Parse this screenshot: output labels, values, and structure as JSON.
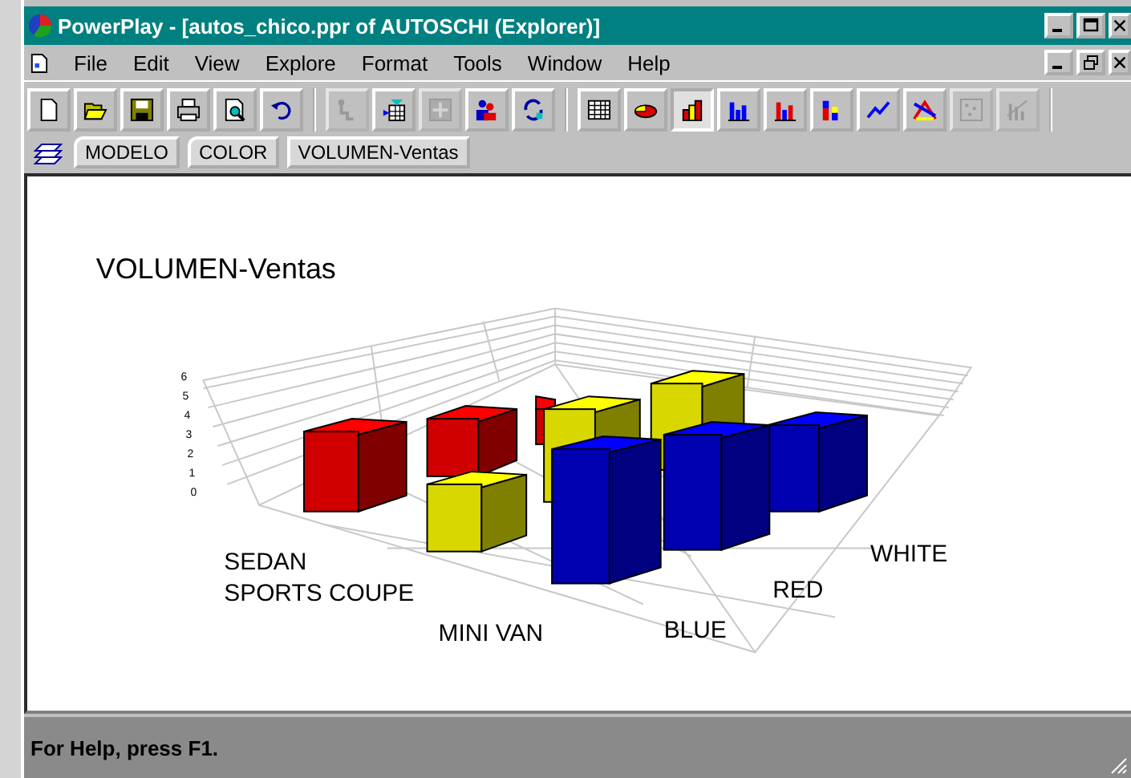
{
  "window": {
    "title": "PowerPlay - [autos_chico.ppr of AUTOSCHI (Explorer)]"
  },
  "menu": [
    {
      "label": "File"
    },
    {
      "label": "Edit"
    },
    {
      "label": "View"
    },
    {
      "label": "Explore"
    },
    {
      "label": "Format"
    },
    {
      "label": "Tools"
    },
    {
      "label": "Window"
    },
    {
      "label": "Help"
    }
  ],
  "toolbar": [
    [
      {
        "kind": "new",
        "pressed": false,
        "disabled": false
      },
      {
        "kind": "open",
        "pressed": false,
        "disabled": false
      },
      {
        "kind": "save",
        "pressed": false,
        "disabled": false
      },
      {
        "kind": "print",
        "pressed": false,
        "disabled": false
      },
      {
        "kind": "preview",
        "pressed": false,
        "disabled": false
      },
      {
        "kind": "undo",
        "pressed": false,
        "disabled": false
      }
    ],
    [
      {
        "kind": "drill",
        "pressed": false,
        "disabled": true
      },
      {
        "kind": "filter",
        "pressed": false,
        "disabled": false
      },
      {
        "kind": "add",
        "pressed": false,
        "disabled": true
      },
      {
        "kind": "people",
        "pressed": false,
        "disabled": false
      },
      {
        "kind": "swap",
        "pressed": false,
        "disabled": false
      }
    ],
    [
      {
        "kind": "crosstab",
        "pressed": false,
        "disabled": false
      },
      {
        "kind": "pie",
        "pressed": false,
        "disabled": false
      },
      {
        "kind": "bar3d",
        "pressed": true,
        "disabled": false
      },
      {
        "kind": "bars",
        "pressed": false,
        "disabled": false
      },
      {
        "kind": "redbars",
        "pressed": false,
        "disabled": false
      },
      {
        "kind": "stacked",
        "pressed": false,
        "disabled": false
      },
      {
        "kind": "line",
        "pressed": false,
        "disabled": false
      },
      {
        "kind": "correlation",
        "pressed": false,
        "disabled": false
      },
      {
        "kind": "scatter",
        "pressed": false,
        "disabled": true
      },
      {
        "kind": "pareto",
        "pressed": false,
        "disabled": true
      }
    ]
  ],
  "tabs": [
    {
      "label": "MODELO",
      "kind": "folder"
    },
    {
      "label": "COLOR",
      "kind": "folder"
    },
    {
      "label": "VOLUMEN-Ventas",
      "kind": "plain"
    }
  ],
  "chart": {
    "title": "VOLUMEN-Ventas",
    "axis_ticks": [
      "6",
      "5",
      "4",
      "3",
      "2",
      "1",
      "0"
    ],
    "row_labels": [
      "SEDAN",
      "SPORTS COUPE",
      "MINI VAN"
    ],
    "column_labels": [
      "BLUE",
      "RED",
      "WHITE"
    ]
  },
  "status_bar": "For Help, press F1."
}
